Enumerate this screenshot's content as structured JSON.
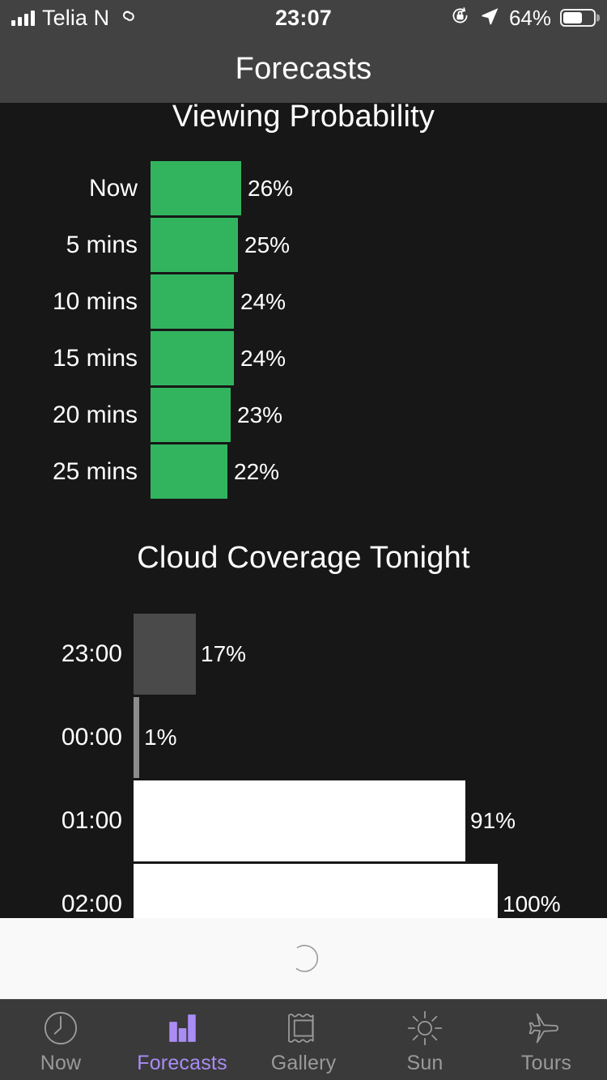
{
  "status_bar": {
    "carrier": "Telia N",
    "time": "23:07",
    "battery_percent": "64%",
    "signal_icon": "signal-bars-icon",
    "link_icon": "personal-hotspot-icon",
    "rotation_lock_icon": "rotation-lock-icon",
    "location_icon": "location-arrow-icon",
    "battery_icon": "battery-icon",
    "battery_level": 64
  },
  "nav_bar": {
    "title": "Forecasts"
  },
  "chart_data": [
    {
      "type": "bar",
      "orientation": "horizontal",
      "title": "Viewing Probability",
      "xlabel": "",
      "ylabel": "",
      "xlim": [
        0,
        100
      ],
      "grid": false,
      "legend": "none",
      "bar_color": "#32b45e",
      "categories": [
        "Now",
        "5 mins",
        "10 mins",
        "15 mins",
        "20 mins",
        "25 mins"
      ],
      "values": [
        26,
        25,
        24,
        24,
        23,
        22
      ],
      "value_labels": [
        "26%",
        "25%",
        "24%",
        "24%",
        "23%",
        "22%"
      ]
    },
    {
      "type": "bar",
      "orientation": "horizontal",
      "title": "Cloud Coverage Tonight",
      "xlabel": "",
      "ylabel": "",
      "xlim": [
        0,
        100
      ],
      "grid": false,
      "legend": "none",
      "categories": [
        "23:00",
        "00:00",
        "01:00",
        "02:00"
      ],
      "values": [
        17,
        1,
        91,
        100
      ],
      "value_labels": [
        "17%",
        "1%",
        "91%",
        "100%"
      ],
      "bar_colors": [
        "#4a4a4a",
        "#8c8c8c",
        "#ffffff",
        "#ffffff"
      ]
    }
  ],
  "loading": {
    "spinner_icon": "loading-spinner-icon"
  },
  "tab_bar": {
    "active_color": "#a98cf5",
    "inactive_color": "#9a9a9a",
    "items": [
      {
        "label": "Now",
        "icon": "clock-icon",
        "active": false
      },
      {
        "label": "Forecasts",
        "icon": "bar-chart-icon",
        "active": true
      },
      {
        "label": "Gallery",
        "icon": "picture-frame-icon",
        "active": false
      },
      {
        "label": "Sun",
        "icon": "sun-icon",
        "active": false
      },
      {
        "label": "Tours",
        "icon": "airplane-icon",
        "active": false
      }
    ]
  }
}
